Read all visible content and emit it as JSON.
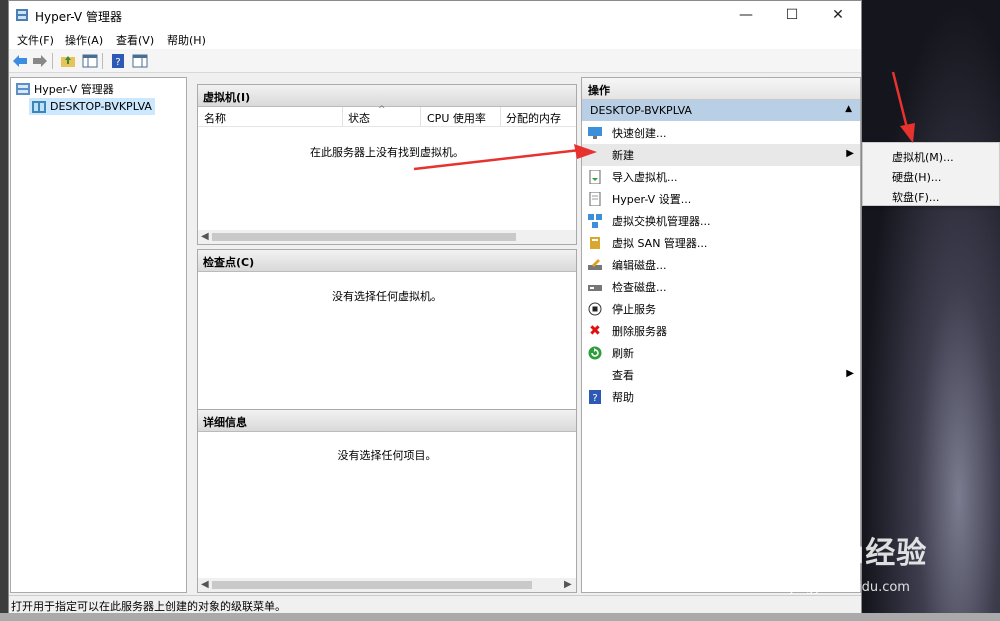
{
  "window": {
    "title": "Hyper-V 管理器"
  },
  "menubar": [
    "文件(F)",
    "操作(A)",
    "查看(V)",
    "帮助(H)"
  ],
  "tree": {
    "root": "Hyper-V 管理器",
    "server": "DESKTOP-BVKPLVA"
  },
  "vm_pane": {
    "title": "虚拟机(I)",
    "columns": [
      "名称",
      "状态",
      "CPU 使用率",
      "分配的内存"
    ],
    "empty": "在此服务器上没有找到虚拟机。"
  },
  "checkpoint_pane": {
    "title": "检查点(C)",
    "empty": "没有选择任何虚拟机。"
  },
  "details_pane": {
    "title": "详细信息",
    "empty": "没有选择任何项目。"
  },
  "actions": {
    "title": "操作",
    "section": "DESKTOP-BVKPLVA",
    "items": [
      {
        "label": "快速创建...",
        "icon": "quick-create-icon"
      },
      {
        "label": "新建",
        "icon": "",
        "submenu": true
      },
      {
        "label": "导入虚拟机...",
        "icon": "import-vm-icon"
      },
      {
        "label": "Hyper-V 设置...",
        "icon": "settings-doc-icon"
      },
      {
        "label": "虚拟交换机管理器...",
        "icon": "switch-manager-icon"
      },
      {
        "label": "虚拟 SAN 管理器...",
        "icon": "san-manager-icon"
      },
      {
        "label": "编辑磁盘...",
        "icon": "edit-disk-icon"
      },
      {
        "label": "检查磁盘...",
        "icon": "inspect-disk-icon"
      },
      {
        "label": "停止服务",
        "icon": "stop-icon"
      },
      {
        "label": "删除服务器",
        "icon": "delete-icon"
      },
      {
        "label": "刷新",
        "icon": "refresh-icon"
      },
      {
        "label": "查看",
        "icon": "",
        "submenu": true
      },
      {
        "label": "帮助",
        "icon": "help-icon"
      }
    ]
  },
  "submenu": [
    "虚拟机(M)...",
    "硬盘(H)...",
    "软盘(F)..."
  ],
  "status": "打开用于指定可以在此服务器上创建的对象的级联菜单。",
  "watermark": {
    "main": "Baidu经验",
    "url": "jingyan.baidu.com"
  },
  "colors": {
    "accent_arrow": "#e8322e",
    "section_bg": "#b9cfe6",
    "selection": "#cce8ff"
  }
}
